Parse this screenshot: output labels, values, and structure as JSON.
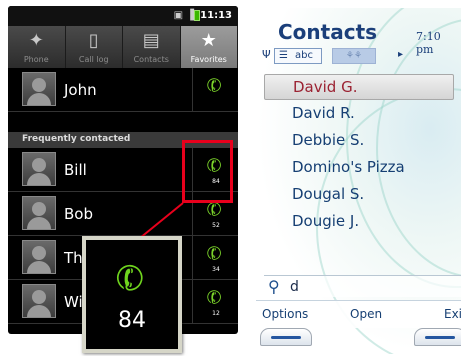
{
  "android": {
    "status_time": "11:13",
    "tabs": [
      {
        "label": "Phone",
        "icon": "phone-tab-icon"
      },
      {
        "label": "Call log",
        "icon": "call-log-icon"
      },
      {
        "label": "Contacts",
        "icon": "contacts-icon"
      },
      {
        "label": "Favorites",
        "icon": "star-icon",
        "active": true
      }
    ],
    "starred_contact": "John",
    "section_header": "Frequently contacted",
    "frequent_contacts": [
      {
        "name": "Bill",
        "count": "84"
      },
      {
        "name": "Bob",
        "count": "52"
      },
      {
        "name": "Tha",
        "count": "34"
      },
      {
        "name": "Wils",
        "count": "12"
      }
    ],
    "callout_count": "84",
    "highlight_color": "#e8001c",
    "call_icon_color": "#7ad22a"
  },
  "nokia": {
    "title": "Contacts",
    "time": "7:10 pm",
    "tab_label": "abc",
    "contacts": [
      "David G.",
      "David R.",
      "Debbie S.",
      "Domino's Pizza",
      "Dougal S.",
      "Dougie J."
    ],
    "selected_index": 0,
    "search_value": "d",
    "softkeys": {
      "left": "Options",
      "middle": "Open",
      "right": "Exi"
    },
    "title_color": "#1b3f7a",
    "selected_text_color": "#9b2232"
  }
}
